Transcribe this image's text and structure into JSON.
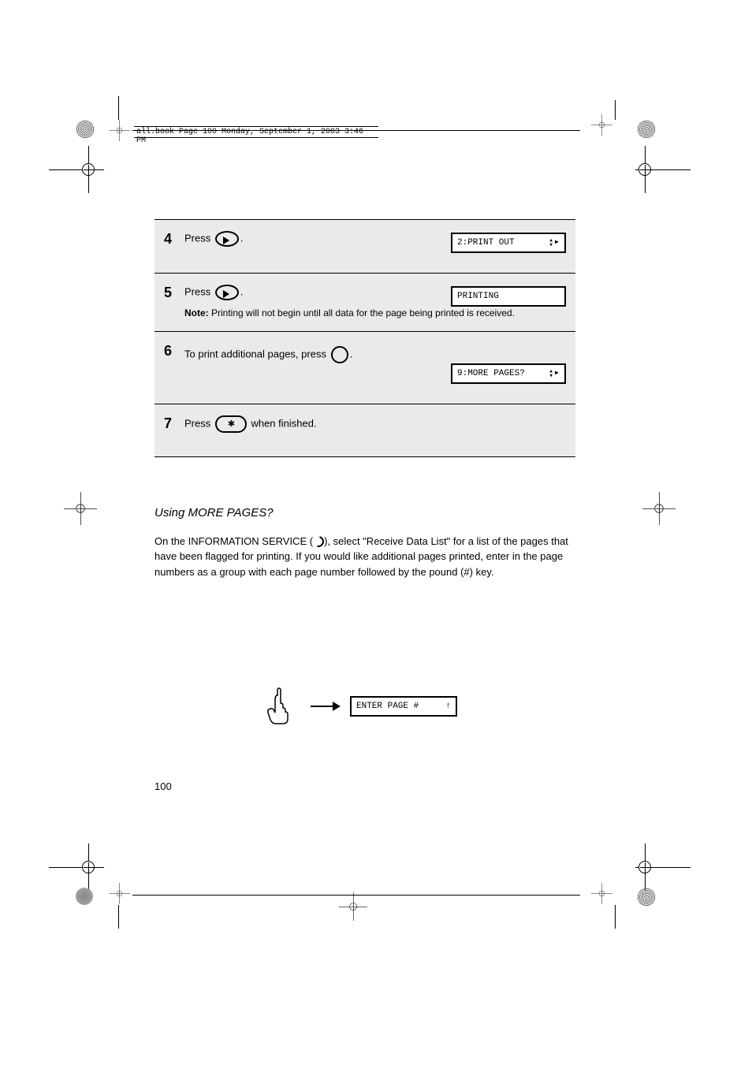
{
  "header": {
    "filename_line": "all.book  Page 100  Monday, September 1, 2003  3:46 PM"
  },
  "steps": [
    {
      "num": "4",
      "prefix": "Press ",
      "suffix": ".",
      "display": "2:PRINT OUT",
      "has_arrows": true
    },
    {
      "num": "5",
      "prefix": "Press ",
      "suffix": ".",
      "display": "PRINTING",
      "has_arrows": false,
      "note_label": "Note: ",
      "note_text": "Printing will not begin until all data for the page being printed is received."
    },
    {
      "num": "6",
      "prefix": "To print additional pages, press ",
      "suffix": ".",
      "display": "9:MORE PAGES?",
      "has_arrows": true
    },
    {
      "num": "7",
      "prefix": "Press ",
      "suffix": " when finished."
    }
  ],
  "more_pages": {
    "heading": "Using MORE PAGES?",
    "para1_a": "On the INFORMATION SERVICE (",
    "para1_b": "), select \"Receive Data List\" for a list of the pages that have been flagged for printing. If you would like additional pages printed, enter in the page numbers as a group with each page number followed by the pound (#) key.",
    "illus_display": "ENTER PAGE #",
    "illus_arrow": "↑"
  },
  "page_number": "100"
}
